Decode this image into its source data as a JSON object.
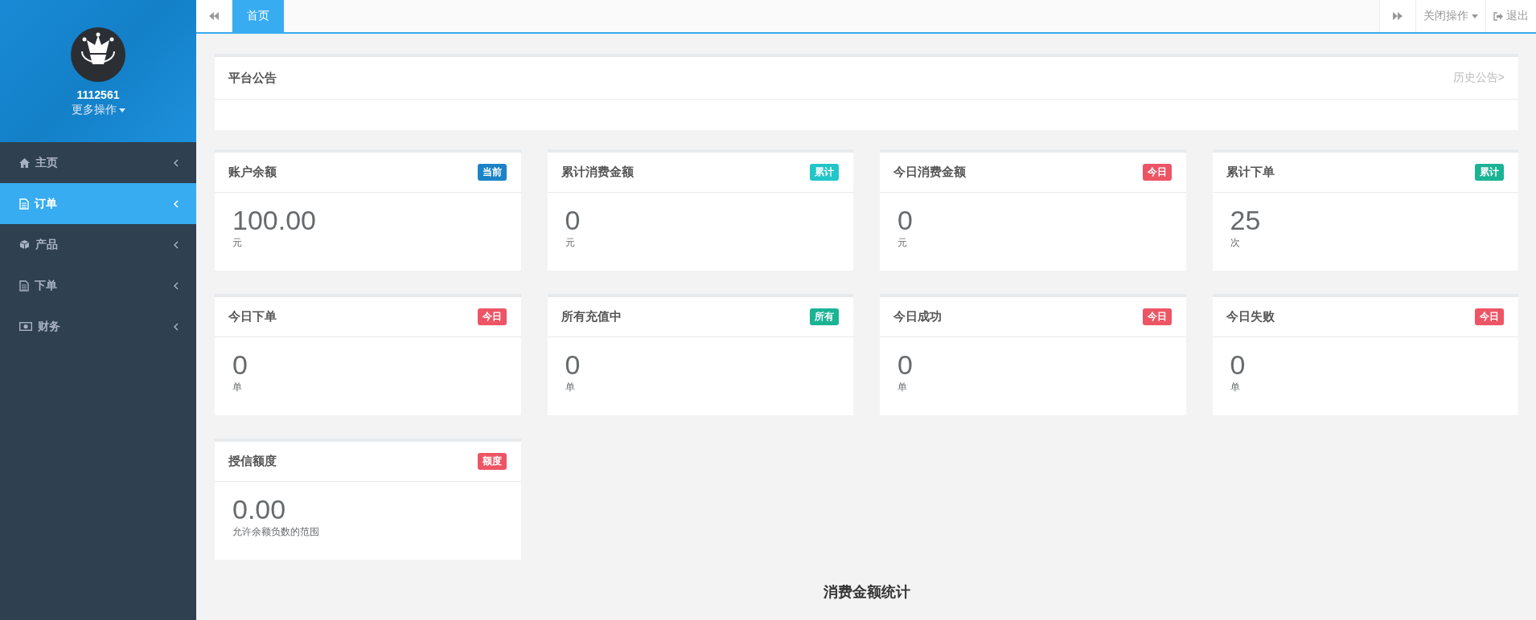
{
  "sidebar": {
    "user_id": "1112561",
    "more_actions": "更多操作",
    "items": [
      {
        "label": "主页",
        "kind": "home",
        "selected": false
      },
      {
        "label": "订单",
        "kind": "document",
        "selected": true
      },
      {
        "label": "产品",
        "kind": "cube",
        "selected": false
      },
      {
        "label": "下单",
        "kind": "document",
        "selected": false
      },
      {
        "label": "财务",
        "kind": "money",
        "selected": false
      }
    ]
  },
  "topbar": {
    "tabs": [
      {
        "label": "首页",
        "selected": true
      }
    ],
    "close_actions": "关闭操作",
    "logout": "退出"
  },
  "notice": {
    "title": "平台公告",
    "history_link": "历史公告>"
  },
  "cards": [
    {
      "title": "账户余额",
      "badge": "当前",
      "color": "#1c84c6",
      "value": "100.00",
      "unit": "元"
    },
    {
      "title": "累计消费金额",
      "badge": "累计",
      "color": "#23c6c8",
      "value": "0",
      "unit": "元"
    },
    {
      "title": "今日消费金额",
      "badge": "今日",
      "color": "#ed5565",
      "value": "0",
      "unit": "元"
    },
    {
      "title": "累计下单",
      "badge": "累计",
      "color": "#1ab394",
      "value": "25",
      "unit": "次"
    },
    {
      "title": "今日下单",
      "badge": "今日",
      "color": "#ed5565",
      "value": "0",
      "unit": "单"
    },
    {
      "title": "所有充值中",
      "badge": "所有",
      "color": "#1ab394",
      "value": "0",
      "unit": "单"
    },
    {
      "title": "今日成功",
      "badge": "今日",
      "color": "#ed5565",
      "value": "0",
      "unit": "单"
    },
    {
      "title": "今日失败",
      "badge": "今日",
      "color": "#ed5565",
      "value": "0",
      "unit": "单"
    },
    {
      "title": "授信额度",
      "badge": "额度",
      "color": "#ed5565",
      "value": "0.00",
      "unit": "允许余额负数的范围"
    }
  ],
  "stats_title": "消费金额统计"
}
